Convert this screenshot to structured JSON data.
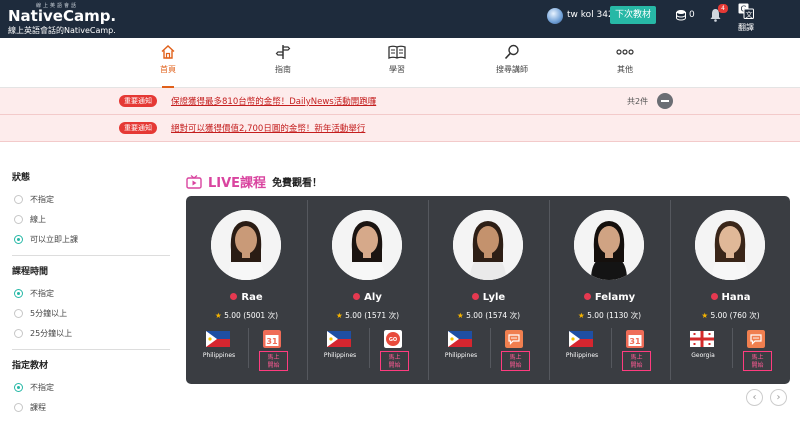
{
  "header": {
    "logo_small": "線上英語會話",
    "logo": "NativeCamp.",
    "logo_sub": "線上英語會話的NativeCamp.",
    "user_name": "tw kol 342",
    "next_button": "下次教材",
    "coins": "0",
    "notification_count": "4",
    "translate": "翻譯"
  },
  "nav": {
    "items": [
      {
        "label": "首頁",
        "icon": "home-icon"
      },
      {
        "label": "指南",
        "icon": "signpost-icon"
      },
      {
        "label": "學習",
        "icon": "book-icon"
      },
      {
        "label": "搜尋講師",
        "icon": "search-icon"
      },
      {
        "label": "其他",
        "icon": "more-icon"
      }
    ]
  },
  "notices": [
    {
      "tag": "重要通知",
      "text": "保證獲得最多810台幣的金幣！DailyNews活動開跑囉",
      "count": "共2件"
    },
    {
      "tag": "重要通知",
      "text": "絕對可以獲得價值2,700日圓的金幣！新年活動舉行"
    }
  ],
  "filters": {
    "status": {
      "title": "狀態",
      "options": [
        "不指定",
        "線上",
        "可以立即上課"
      ],
      "selected": 2
    },
    "duration": {
      "title": "課程時間",
      "options": [
        "不指定",
        "5分鐘以上",
        "25分鐘以上"
      ],
      "selected": 0
    },
    "material": {
      "title": "指定教材",
      "options": [
        "不指定",
        "課程"
      ],
      "selected": 0
    }
  },
  "live": {
    "title": "LIVE課程",
    "subtitle": "免費觀看！",
    "start_label_1": "馬上",
    "start_label_2": "開始",
    "teachers": [
      {
        "name": "Rae",
        "rating": "5.00 (5001 次)",
        "country": "Philippines",
        "course": "calendar-icon"
      },
      {
        "name": "Aly",
        "rating": "5.00 (1571 次)",
        "country": "Philippines",
        "course": "lets-go-icon"
      },
      {
        "name": "Lyle",
        "rating": "5.00 (1574 次)",
        "country": "Philippines",
        "course": "chat-icon"
      },
      {
        "name": "Felamy",
        "rating": "5.00 (1130 次)",
        "country": "Philippines",
        "course": "calendar-icon"
      },
      {
        "name": "Hana",
        "rating": "5.00 (760 次)",
        "country": "Georgia",
        "course": "chat-icon"
      }
    ]
  },
  "colors": {
    "accent": "#27b8a6",
    "live": "#d9449f",
    "alert": "#e53935",
    "header": "#1e2b3c"
  }
}
